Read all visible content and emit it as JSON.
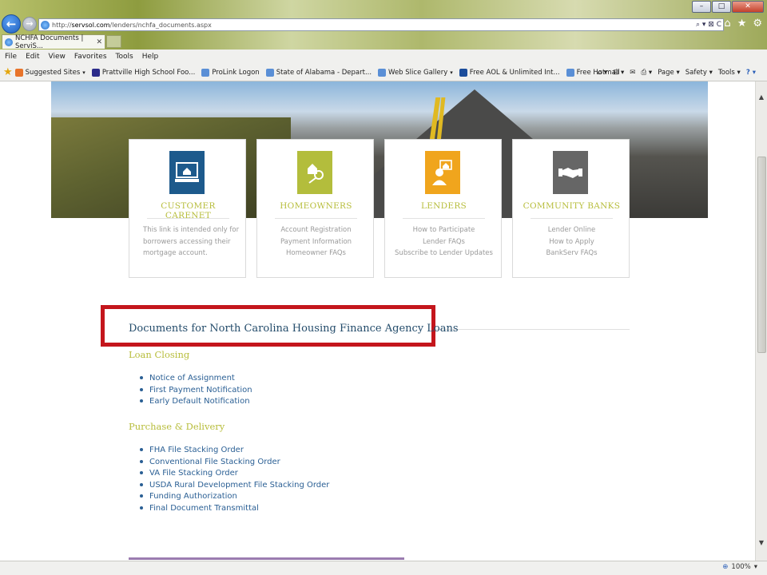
{
  "browser": {
    "url_prefix": "http://",
    "url_domain": "servsol.com",
    "url_path": "/lenders/nchfa_documents.aspx",
    "tab_title": "NCHFA Documents | ServiS...",
    "tab_close": "✕",
    "window_controls": [
      "–",
      "□",
      "✕"
    ],
    "nav_back": "←",
    "nav_forward": "→",
    "address_tools": "⌕ ▾ ⊠ C",
    "right_icons": [
      "⌂",
      "★",
      "⚙"
    ]
  },
  "menu": [
    "File",
    "Edit",
    "View",
    "Favorites",
    "Tools",
    "Help"
  ],
  "favorites": [
    {
      "label": "Suggested Sites",
      "dropdown": true,
      "color": "#e8742a"
    },
    {
      "label": "Prattville High School Foo...",
      "dropdown": false,
      "color": "#2b2b8a"
    },
    {
      "label": "ProLink Logon",
      "dropdown": false,
      "color": "#5a8fd6"
    },
    {
      "label": "State of Alabama - Depart...",
      "dropdown": false,
      "color": "#5a8fd6"
    },
    {
      "label": "Web Slice Gallery",
      "dropdown": true,
      "color": "#5a8fd6"
    },
    {
      "label": "Free AOL & Unlimited Int...",
      "dropdown": false,
      "color": "#1b4d9b"
    },
    {
      "label": "Free Hotmail",
      "dropdown": false,
      "color": "#5a8fd6"
    }
  ],
  "command_bar": [
    "Page",
    "Safety",
    "Tools"
  ],
  "cards": [
    {
      "title": "CUSTOMER CARENET",
      "icon": "computer-home-icon",
      "icon_color": "#1d5a8c",
      "lines": [
        "This link is intended only for",
        "borrowers accessing their",
        "mortgage account."
      ]
    },
    {
      "title": "HOMEOWNERS",
      "icon": "house-keys-icon",
      "icon_color": "#b3bd3c",
      "lines": [
        "Account Registration",
        "Payment Information",
        "Homeowner FAQs"
      ]
    },
    {
      "title": "LENDERS",
      "icon": "lender-person-icon",
      "icon_color": "#f0a51d",
      "lines": [
        "How to Participate",
        "Lender FAQs",
        "Subscribe to Lender Updates"
      ]
    },
    {
      "title": "COMMUNITY BANKS",
      "icon": "handshake-icon",
      "icon_color": "#666666",
      "lines": [
        "Lender Online",
        "How to Apply",
        "BankServ FAQs"
      ]
    }
  ],
  "docs": {
    "heading": "Documents for North Carolina Housing Finance Agency Loans",
    "highlight_color": "#c4161c",
    "sections": [
      {
        "title": "Loan Closing",
        "items": [
          "Notice of Assignment",
          "First Payment Notification",
          "Early Default Notification"
        ]
      },
      {
        "title": "Purchase & Delivery",
        "items": [
          "FHA File Stacking Order",
          "Conventional File Stacking Order",
          "VA File Stacking Order",
          "USDA Rural Development File Stacking Order",
          "Funding Authorization",
          "Final Document Transmittal"
        ]
      }
    ]
  },
  "status": {
    "zoom": "100%"
  }
}
